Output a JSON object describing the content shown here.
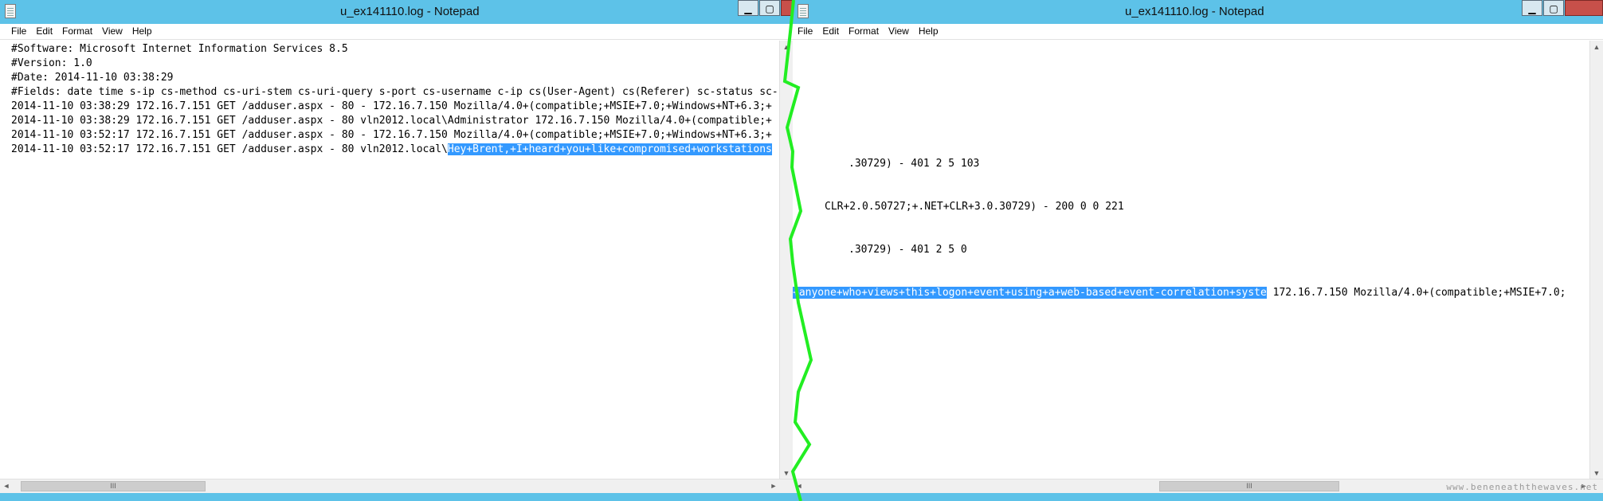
{
  "windows": {
    "left": {
      "title": "u_ex141110.log - Notepad",
      "caption_buttons": {
        "minimize": "▁",
        "maximize": "▢",
        "close": ""
      }
    },
    "right": {
      "title": "u_ex141110.log - Notepad",
      "caption_buttons": {
        "minimize": "▁",
        "maximize": "▢",
        "close": ""
      }
    }
  },
  "menu": [
    "File",
    "Edit",
    "Format",
    "View",
    "Help"
  ],
  "log": {
    "header_lines": [
      "#Software: Microsoft Internet Information Services 8.5",
      "#Version: 1.0",
      "#Date: 2014-11-10 03:38:29"
    ],
    "left": {
      "fields_line": "#Fields: date time s-ip cs-method cs-uri-stem cs-uri-query s-port cs-username c-ip cs(User-Agent) cs(Referer) sc-status sc-",
      "lines": [
        "2014-11-10 03:38:29 172.16.7.151 GET /adduser.aspx - 80 - 172.16.7.150 Mozilla/4.0+(compatible;+MSIE+7.0;+Windows+NT+6.3;+",
        "2014-11-10 03:38:29 172.16.7.151 GET /adduser.aspx - 80 vln2012.local\\Administrator 172.16.7.150 Mozilla/4.0+(compatible;+",
        "2014-11-10 03:52:17 172.16.7.151 GET /adduser.aspx - 80 - 172.16.7.150 Mozilla/4.0+(compatible;+MSIE+7.0;+Windows+NT+6.3;+"
      ],
      "last_prefix": "2014-11-10 03:52:17 172.16.7.151 GET /adduser.aspx - 80 vln2012.local\\",
      "last_selected": "Hey+Brent,+I+heard+you+like+compromised+workstations"
    },
    "right": {
      "lines": [
        ".30729) - 401 2 5 103",
        "CLR+2.0.50727;+.NET+CLR+3.0.30729) - 200 0 0 221",
        ".30729) - 401 2 5 0"
      ],
      "last_selected": "+anyone+who+views+this+logon+event+using+a+web-based+event-correlation+syste",
      "last_suffix": " 172.16.7.150 Mozilla/4.0+(compatible;+MSIE+7.0;"
    }
  },
  "scrollbar": {
    "thumb_grip": "III",
    "arrows": {
      "up": "▲",
      "down": "▼",
      "left": "◄",
      "right": "►"
    }
  },
  "watermark": "www.beneneaththewaves.net",
  "colors": {
    "titlebar": "#5dc2e8",
    "selection": "#3399ff",
    "tear_line": "#22ee22",
    "close_button": "#c7504a"
  }
}
